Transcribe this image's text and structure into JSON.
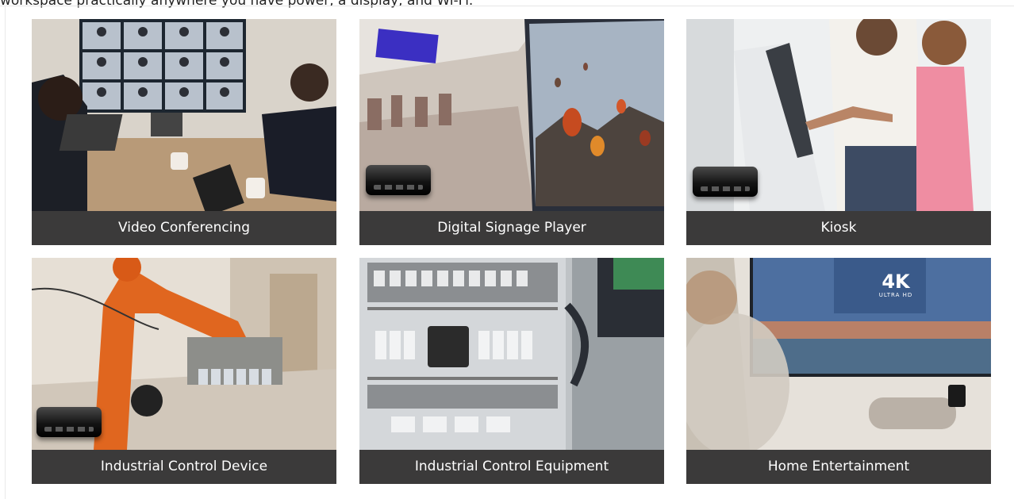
{
  "header": {
    "text": "workspace practically anywhere you have power, a display, and Wi-Fi."
  },
  "cards": [
    {
      "caption": "Video Conferencing"
    },
    {
      "caption": "Digital Signage Player"
    },
    {
      "caption": "Kiosk"
    },
    {
      "caption": "Industrial Control Device"
    },
    {
      "caption": "Industrial Control Equipment"
    },
    {
      "caption": "Home Entertainment"
    }
  ],
  "tv_logo": {
    "big": "4K",
    "small": "ULTRA HD"
  }
}
